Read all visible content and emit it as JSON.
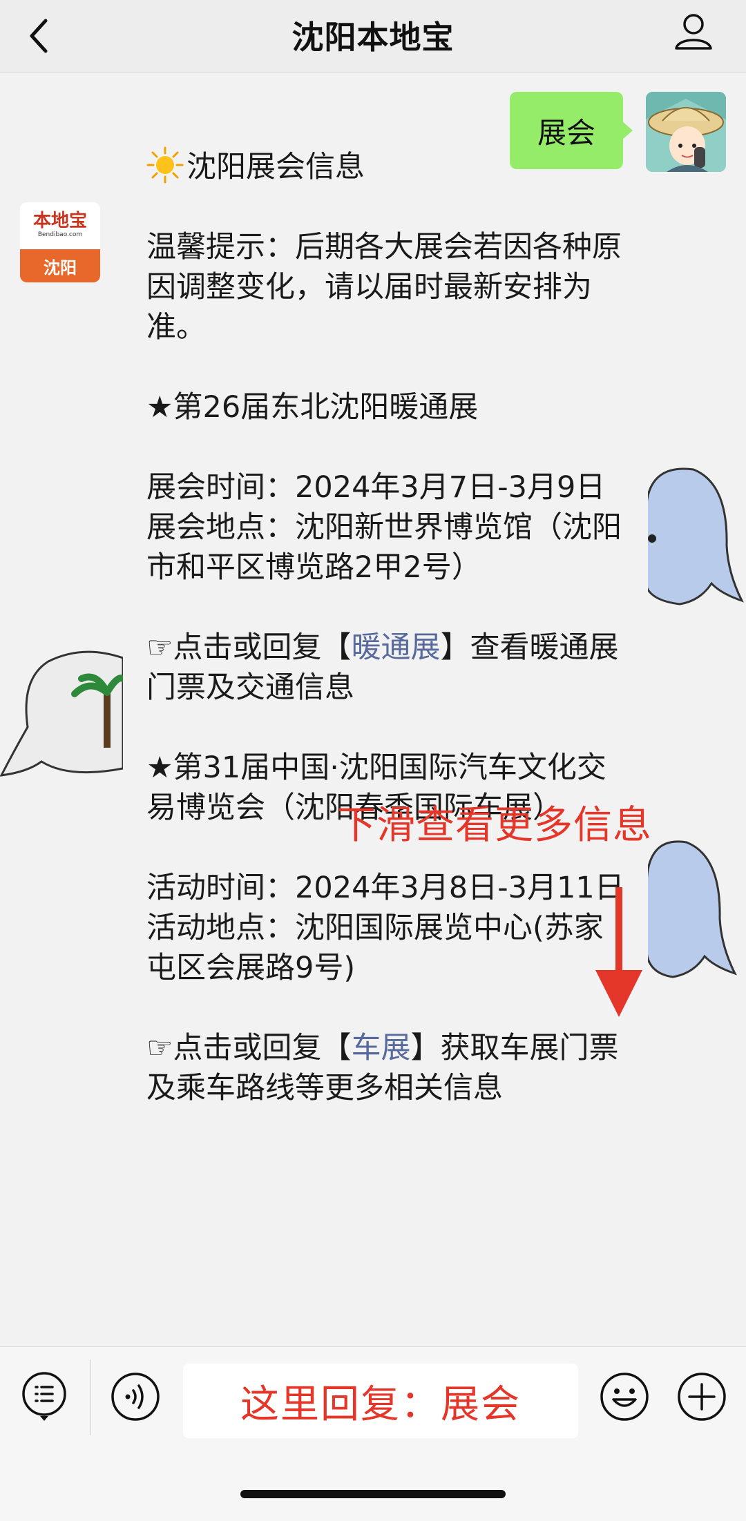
{
  "header": {
    "title": "沈阳本地宝"
  },
  "outgoing": {
    "text": "展会"
  },
  "bot_avatar": {
    "brand": "本地宝",
    "domain": "Bendibao.com",
    "city": "沈阳"
  },
  "message": {
    "title": "沈阳展会信息",
    "tip": "温馨提示：后期各大展会若因各种原因调整变化，请以届时最新安排为准。",
    "expo1": {
      "name": "★第26届东北沈阳暖通展",
      "time": "展会时间：2024年3月7日-3月9日",
      "place": "展会地点：沈阳新世界博览馆（沈阳市和平区博览路2甲2号）",
      "action_prefix": "☞点击或回复【",
      "action_link": "暖通展",
      "action_suffix": "】查看暖通展门票及交通信息"
    },
    "expo2": {
      "name": "★第31届中国·沈阳国际汽车文化交易博览会（沈阳春季国际车展）",
      "time": "活动时间：2024年3月8日-3月11日",
      "place": "活动地点：沈阳国际展览中心(苏家屯区会展路9号)",
      "action_prefix": "☞点击或回复【",
      "action_link": "车展",
      "action_suffix": "】获取车展门票及乘车路线等更多相关信息"
    }
  },
  "overlay": {
    "scroll_hint": "下滑查看更多信息"
  },
  "input": {
    "hint_text": "这里回复：展会"
  },
  "colors": {
    "outgoing_bubble": "#95ec69",
    "link": "#586a9c",
    "annotation": "#e5362a"
  }
}
